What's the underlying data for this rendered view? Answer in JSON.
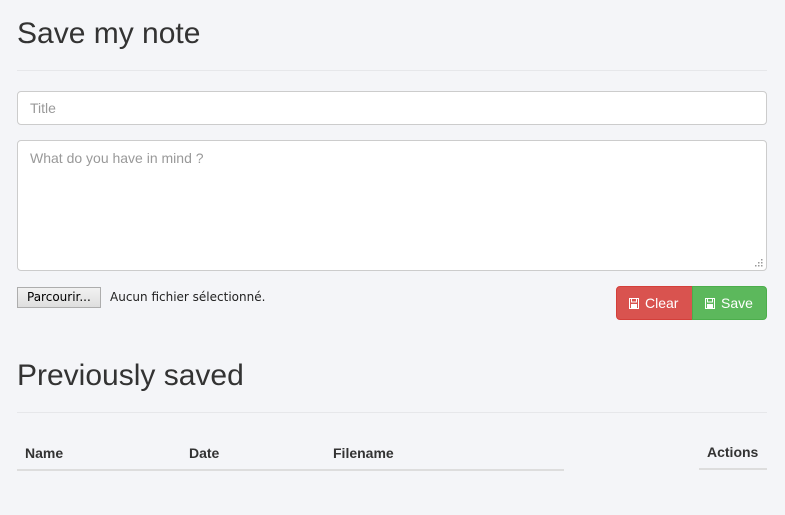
{
  "note_form": {
    "heading": "Save my note",
    "title_placeholder": "Title",
    "title_value": "",
    "body_placeholder": "What do you have in mind ?",
    "body_value": "",
    "file_button_label": "Parcourir...",
    "file_status": "Aucun fichier sélectionné.",
    "clear_label": "Clear",
    "save_label": "Save",
    "clear_icon": "floppy-icon",
    "save_icon": "floppy-icon"
  },
  "saved": {
    "heading": "Previously saved",
    "columns": [
      "Name",
      "Date",
      "Filename",
      "Actions"
    ],
    "rows": []
  },
  "colors": {
    "danger": "#d9534f",
    "success": "#5cb85c",
    "background": "#f4f5f8"
  }
}
